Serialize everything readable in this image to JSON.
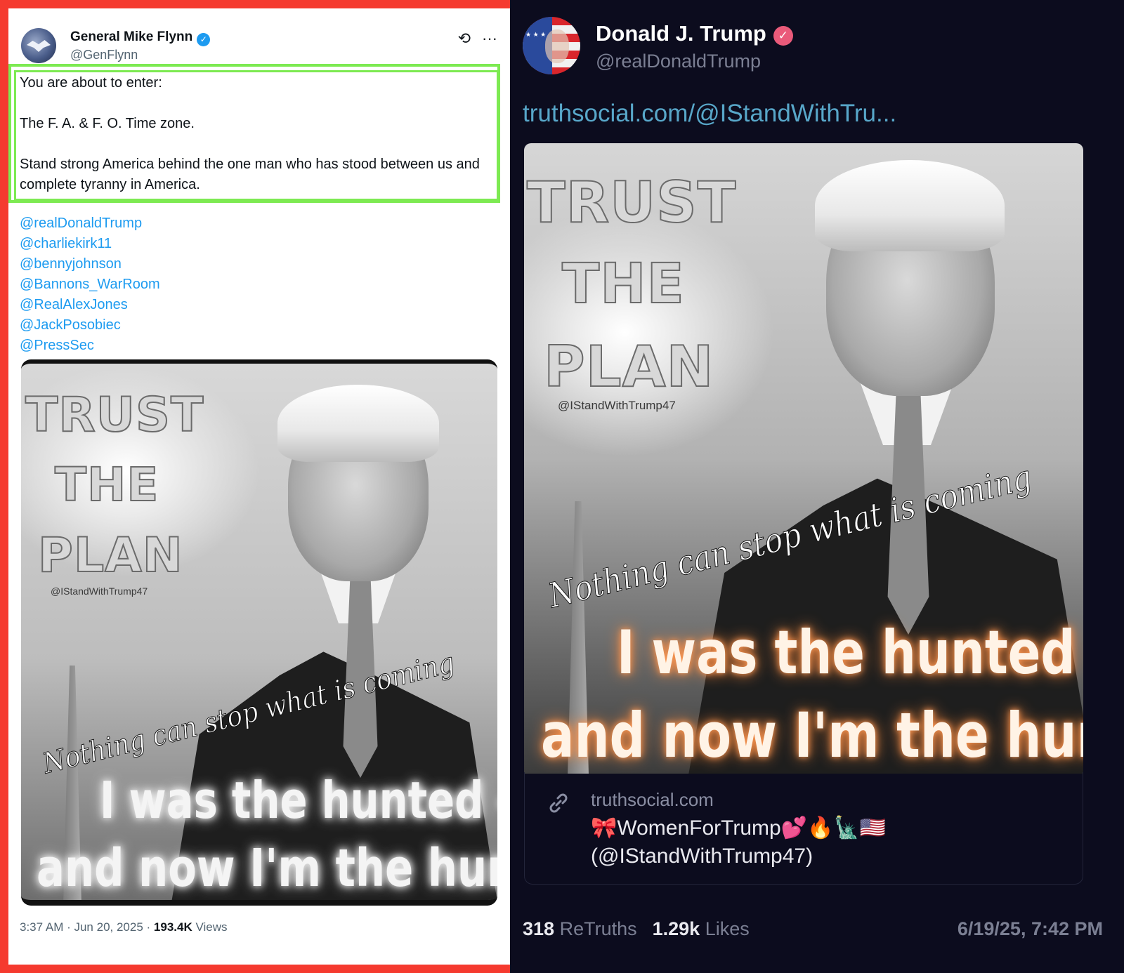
{
  "twitter": {
    "author_name": "General Mike Flynn",
    "verified_glyph": "✓",
    "handle": "@GenFlynn",
    "action_glyphs": [
      "⟲",
      "···"
    ],
    "body": [
      "You are about to enter:",
      "The F. A. & F. O. Time zone.",
      "Stand strong America behind the one man who has stood between us and complete tyranny in America."
    ],
    "mentions": [
      "@realDonaldTrump",
      "@charliekirk11",
      "@bennyjohnson",
      "@Bannons_WarRoom",
      "@RealAlexJones",
      "@JackPosobiec",
      "@PressSec"
    ],
    "time": "3:37 AM · Jun 20, 2025 · ",
    "views_count": "193.4K",
    "views_label": " Views",
    "highlight_color": "#7dea52",
    "frame_color": "#f53a2f"
  },
  "poster": {
    "trust": "TRUST",
    "the": "THE",
    "plan": "PLAN",
    "watermark": "@IStandWithTrump47",
    "script": "Nothing can stop what is coming",
    "line1": "I  was the hunted -",
    "line2": "and now I'm the hunter"
  },
  "truth": {
    "author_name": "Donald J. Trump",
    "verified_glyph": "✓",
    "handle": "@realDonaldTrump",
    "link": "truthsocial.com/@IStandWithTru...",
    "preview_icon": "link-icon",
    "preview_domain": "truthsocial.com",
    "preview_title_1": "🎀WomenForTrump💕🔥🗽🇺🇸",
    "preview_title_2": "(@IStandWithTrump47)",
    "retruths_count": "318",
    "retruths_label": "ReTruths",
    "likes_count": "1.29k",
    "likes_label": "Likes",
    "date": "6/19/25, 7:42 PM",
    "glow_color": "#ff8a3d"
  }
}
